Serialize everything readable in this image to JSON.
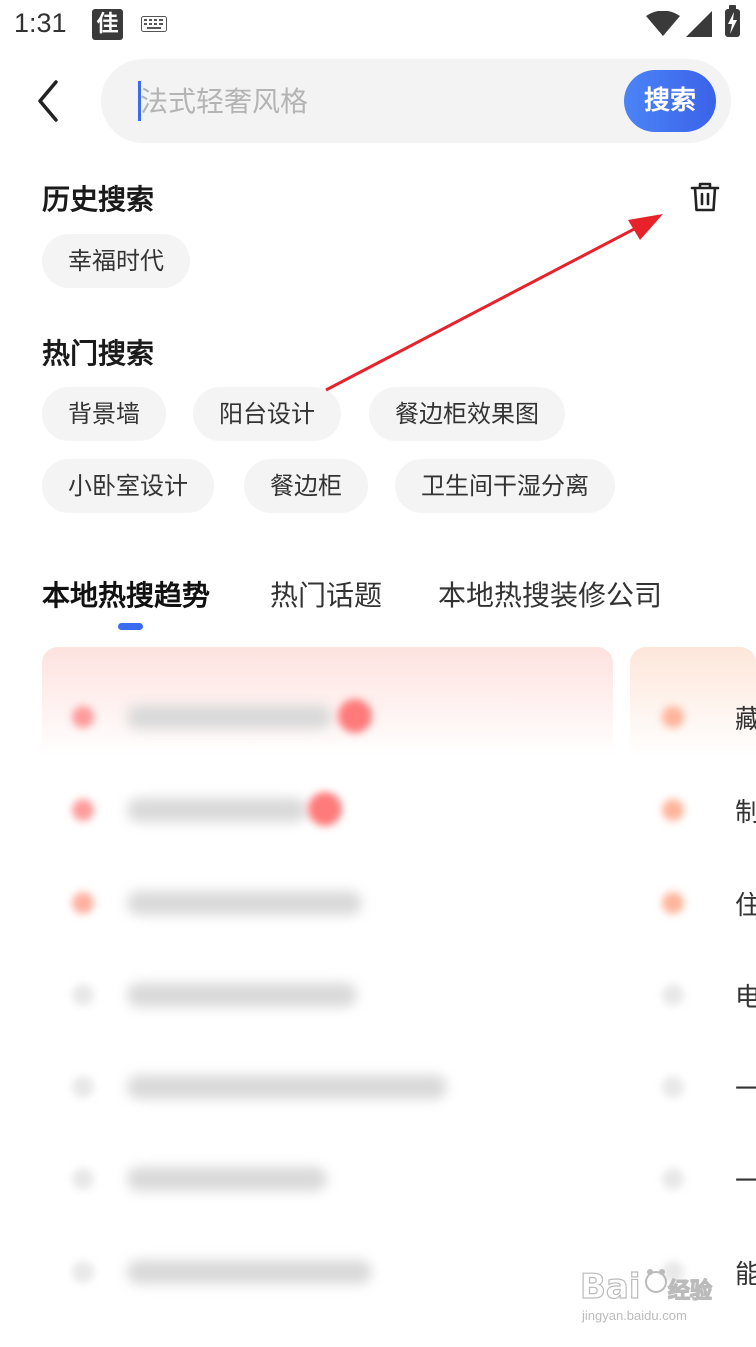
{
  "status_bar": {
    "time": "1:31",
    "app_icon_text": "佳",
    "icons": [
      "keyboard-icon",
      "wifi-icon",
      "signal-icon",
      "battery-charging-icon"
    ]
  },
  "search": {
    "placeholder": "法式轻奢风格",
    "button_label": "搜索"
  },
  "history": {
    "title": "历史搜索",
    "items": [
      "幸福时代"
    ]
  },
  "hot": {
    "title": "热门搜索",
    "items": [
      "背景墙",
      "阳台设计",
      "餐边柜效果图",
      "小卧室设计",
      "餐边柜",
      "卫生间干湿分离"
    ]
  },
  "tabs": [
    {
      "label": "本地热搜趋势",
      "active": true
    },
    {
      "label": "热门话题",
      "active": false
    },
    {
      "label": "本地热搜装修公司",
      "active": false
    }
  ],
  "trend_card_right_peek": [
    "藏",
    "制",
    "住",
    "电",
    "一",
    "一",
    "能"
  ],
  "watermark": {
    "brand": "Bai du 经验",
    "url": "jingyan.baidu.com"
  },
  "colors": {
    "accent": "#3b6cf0",
    "annotation_arrow": "#e8222b"
  }
}
